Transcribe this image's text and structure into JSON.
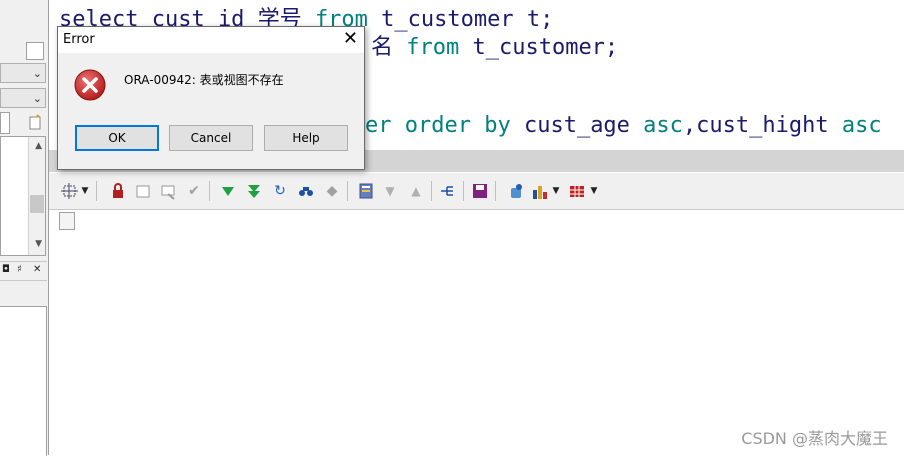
{
  "editor": {
    "line1_part1": "select cust id ",
    "line1_part2": "学号 ",
    "line1_kw": "from",
    "line1_part3": " t_customer t;",
    "line2_part1": "名 ",
    "line2_kw": "from",
    "line2_part2": " t_customer;",
    "line4_part1": "er ",
    "line4_kw": "order by",
    "line4_part2": " cust_age ",
    "line4_kw2": "asc",
    "line4_part3": ",cust_hight ",
    "line4_kw3": "asc"
  },
  "dialog": {
    "title": "Error",
    "message": "ORA-00942: 表或视图不存在",
    "ok_label": "OK",
    "cancel_label": "Cancel",
    "help_label": "Help",
    "close_glyph": "✕"
  },
  "left_panel": {
    "bar_glyphs": [
      "◘",
      "♯",
      "✕"
    ]
  },
  "toolbar": {
    "icons": [
      "select-cursor-icon",
      "lock-icon",
      "new-row-icon",
      "delete-row-icon",
      "post-icon",
      "fetch-next-icon",
      "fetch-last-icon",
      "refresh-icon",
      "query-icon",
      "clear-icon",
      "single-record-icon",
      "sort-down-icon",
      "sort-up-icon",
      "explain-icon",
      "save-icon",
      "connect-icon",
      "chart-icon",
      "export-table-icon"
    ]
  },
  "watermark": "CSDN @蒸肉大魔王",
  "colors": {
    "keyword": "#008080",
    "code": "#1a1a6e",
    "error_red": "#d32f2f",
    "default_button_border": "#0078d7"
  }
}
